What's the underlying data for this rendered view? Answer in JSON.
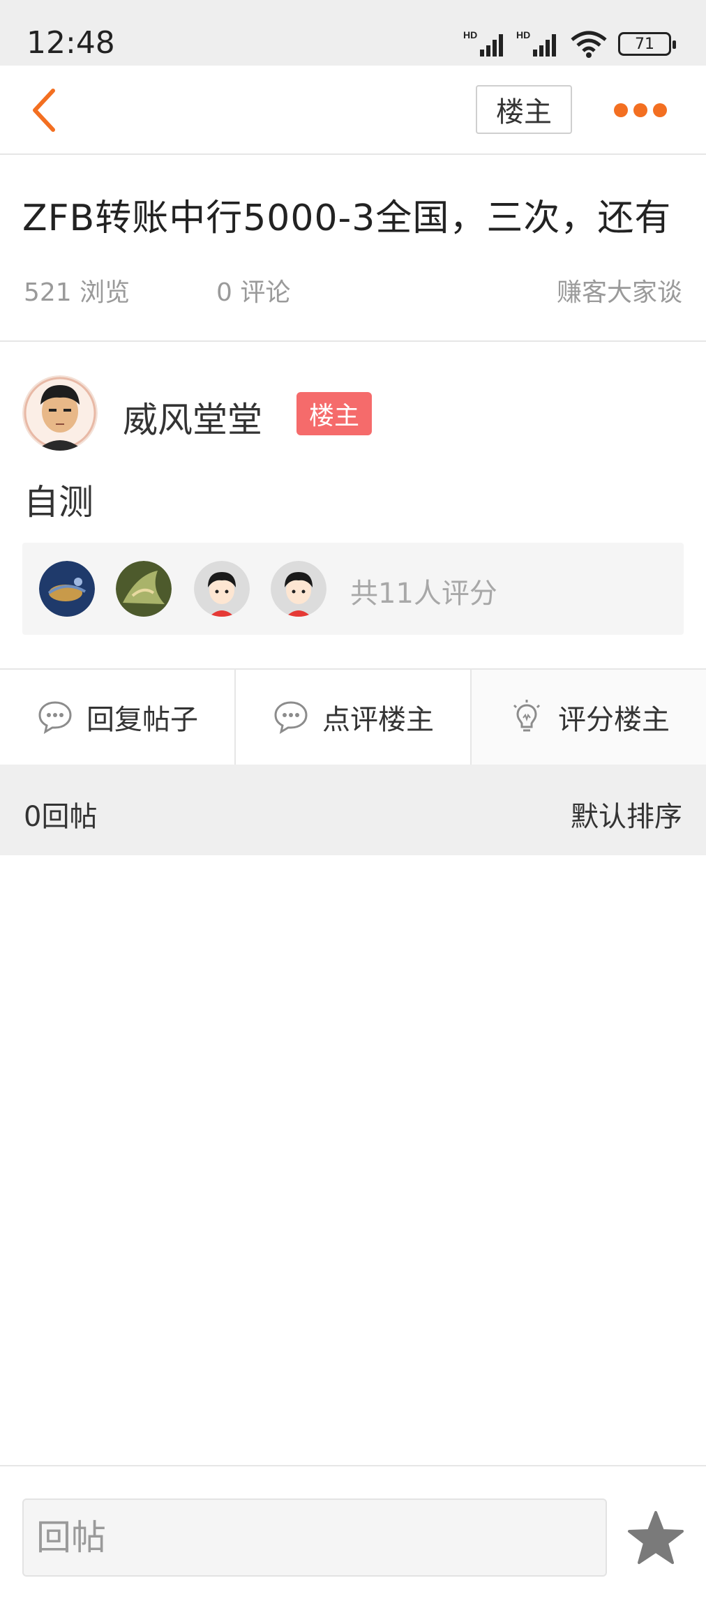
{
  "status_bar": {
    "time": "12:48",
    "signal_labels": [
      "HD",
      "HD"
    ],
    "battery": "71"
  },
  "nav": {
    "back_icon": "chevron-left-icon",
    "op_only_label": "楼主",
    "more_icon": "more-dots-icon",
    "accent": "#f36f21"
  },
  "post": {
    "title": "ZFB转账中行5000-3全国，三次，还有",
    "views": "521 浏览",
    "comments": "0 评论",
    "forum": "赚客大家谈",
    "author": "威风堂堂",
    "op_tag": "楼主",
    "op_tag_color": "#f56b6b",
    "content": "自测"
  },
  "rating": {
    "summary": "共11人评分",
    "raters": [
      "rater-avatar-1",
      "rater-avatar-2",
      "rater-avatar-3",
      "rater-avatar-4"
    ]
  },
  "actions": [
    {
      "label": "回复帖子",
      "icon": "speech-bubble-icon"
    },
    {
      "label": "点评楼主",
      "icon": "speech-bubble-icon"
    },
    {
      "label": "评分楼主",
      "icon": "lightbulb-icon"
    }
  ],
  "replies": {
    "count": "0回帖",
    "sort": "默认排序"
  },
  "bottom": {
    "placeholder": "回帖",
    "favorite_icon": "star-icon"
  }
}
